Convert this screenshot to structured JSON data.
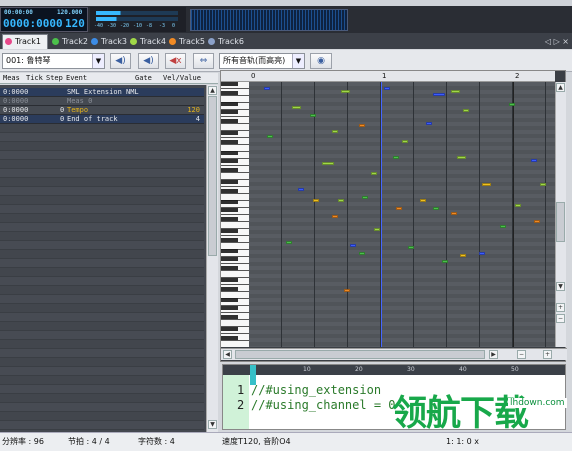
{
  "transport": {
    "label_1": "00:00:00",
    "label_2": "120.000",
    "position": "0000:0000",
    "tempo": "120",
    "meter_ticks": [
      "-40",
      "-30",
      "-20",
      "-10",
      "-8",
      "-3",
      "0"
    ]
  },
  "tabs": [
    {
      "label": "Track1",
      "color": "#e8488a",
      "active": true
    },
    {
      "label": "Track2",
      "color": "#4bc04b"
    },
    {
      "label": "Track3",
      "color": "#3c8ce6"
    },
    {
      "label": "Track4",
      "color": "#a0d848"
    },
    {
      "label": "Track5",
      "color": "#f08a24"
    },
    {
      "label": "Track6",
      "color": "#8aa0c8"
    }
  ],
  "tab_nav": "◁ ▷ ×",
  "toolbar": {
    "instrument": "001: 鲁特琴",
    "track_filter": "所有音轨(而高亮)"
  },
  "event_list": {
    "headers": [
      "Meas",
      "Tick",
      "Step",
      "Event",
      "Gate",
      "Vel/Value"
    ],
    "rows": [
      {
        "meas": "0:0000",
        "step": "",
        "event": "SML Extension NML",
        "value": "",
        "selected": true
      },
      {
        "meas": "0:0000",
        "step": "",
        "event": "Meas 0",
        "value": "",
        "selected": false,
        "dim": true
      },
      {
        "meas": "0:0000",
        "step": "0",
        "event": "Tempo",
        "value": "120",
        "selected": false,
        "tempo": true
      },
      {
        "meas": "0:0000",
        "step": "0",
        "event": "End of track",
        "value": "4",
        "selected": true
      }
    ]
  },
  "ruler": {
    "marks": [
      "0",
      "1",
      "2"
    ]
  },
  "script": {
    "lines": [
      {
        "num": "1",
        "text": "//#using_extension"
      },
      {
        "num": "2",
        "text": "//#using_channel = 0"
      }
    ],
    "ruler_marks": [
      "10",
      "20",
      "30",
      "40",
      "50"
    ]
  },
  "status": {
    "resolution": "分辨率 : 96",
    "beat": "节拍 : 4 / 4",
    "chars": "字符数 : 4",
    "tempo": "速度T120, 音阶O4",
    "position": "1: 1: 0 x"
  },
  "watermark": {
    "text": "领航下载",
    "url": "lhdown.com"
  },
  "notes": [
    {
      "t": 0.05,
      "p": 0.02,
      "w": 0.02,
      "c": "#3c5cff"
    },
    {
      "t": 0.3,
      "p": 0.03,
      "w": 0.03,
      "c": "#a0d848"
    },
    {
      "t": 0.44,
      "p": 0.02,
      "w": 0.02,
      "c": "#3c5cff"
    },
    {
      "t": 0.6,
      "p": 0.04,
      "w": 0.04,
      "c": "#3c5cff"
    },
    {
      "t": 0.66,
      "p": 0.03,
      "w": 0.03,
      "c": "#a0d848"
    },
    {
      "t": 0.14,
      "p": 0.09,
      "w": 0.03,
      "c": "#a0d848"
    },
    {
      "t": 0.2,
      "p": 0.12,
      "w": 0.02,
      "c": "#4bc04b"
    },
    {
      "t": 0.27,
      "p": 0.18,
      "w": 0.02,
      "c": "#a0d848"
    },
    {
      "t": 0.06,
      "p": 0.2,
      "w": 0.02,
      "c": "#4bc04b"
    },
    {
      "t": 0.36,
      "p": 0.16,
      "w": 0.02,
      "c": "#f08a24"
    },
    {
      "t": 0.58,
      "p": 0.15,
      "w": 0.02,
      "c": "#3c5cff"
    },
    {
      "t": 0.5,
      "p": 0.22,
      "w": 0.02,
      "c": "#a0d848"
    },
    {
      "t": 0.7,
      "p": 0.1,
      "w": 0.02,
      "c": "#a0d848"
    },
    {
      "t": 0.85,
      "p": 0.08,
      "w": 0.02,
      "c": "#4bc04b"
    },
    {
      "t": 0.24,
      "p": 0.3,
      "w": 0.04,
      "c": "#a0d848"
    },
    {
      "t": 0.4,
      "p": 0.34,
      "w": 0.02,
      "c": "#a0d848"
    },
    {
      "t": 0.47,
      "p": 0.28,
      "w": 0.02,
      "c": "#4bc04b"
    },
    {
      "t": 0.68,
      "p": 0.28,
      "w": 0.03,
      "c": "#a0d848"
    },
    {
      "t": 0.92,
      "p": 0.29,
      "w": 0.02,
      "c": "#3c5cff"
    },
    {
      "t": 0.95,
      "p": 0.38,
      "w": 0.02,
      "c": "#a0d848"
    },
    {
      "t": 0.16,
      "p": 0.4,
      "w": 0.02,
      "c": "#3c5cff"
    },
    {
      "t": 0.21,
      "p": 0.44,
      "w": 0.02,
      "c": "#f0c020"
    },
    {
      "t": 0.29,
      "p": 0.44,
      "w": 0.02,
      "c": "#a0d848"
    },
    {
      "t": 0.37,
      "p": 0.43,
      "w": 0.02,
      "c": "#4bc04b"
    },
    {
      "t": 0.56,
      "p": 0.44,
      "w": 0.02,
      "c": "#f0c020"
    },
    {
      "t": 0.76,
      "p": 0.38,
      "w": 0.03,
      "c": "#f0c020"
    },
    {
      "t": 0.87,
      "p": 0.46,
      "w": 0.02,
      "c": "#a0d848"
    },
    {
      "t": 0.48,
      "p": 0.47,
      "w": 0.02,
      "c": "#f08a24"
    },
    {
      "t": 0.6,
      "p": 0.47,
      "w": 0.02,
      "c": "#4bc04b"
    },
    {
      "t": 0.66,
      "p": 0.49,
      "w": 0.02,
      "c": "#f08a24"
    },
    {
      "t": 0.27,
      "p": 0.5,
      "w": 0.02,
      "c": "#f08a24"
    },
    {
      "t": 0.41,
      "p": 0.55,
      "w": 0.02,
      "c": "#a0d848"
    },
    {
      "t": 0.82,
      "p": 0.54,
      "w": 0.02,
      "c": "#4bc04b"
    },
    {
      "t": 0.12,
      "p": 0.6,
      "w": 0.02,
      "c": "#4bc04b"
    },
    {
      "t": 0.33,
      "p": 0.61,
      "w": 0.02,
      "c": "#3c5cff"
    },
    {
      "t": 0.93,
      "p": 0.52,
      "w": 0.02,
      "c": "#f08a24"
    },
    {
      "t": 0.36,
      "p": 0.64,
      "w": 0.02,
      "c": "#4bc04b"
    },
    {
      "t": 0.52,
      "p": 0.62,
      "w": 0.02,
      "c": "#4bc04b"
    },
    {
      "t": 0.69,
      "p": 0.65,
      "w": 0.02,
      "c": "#f0c020"
    },
    {
      "t": 0.75,
      "p": 0.64,
      "w": 0.02,
      "c": "#3c5cff"
    },
    {
      "t": 0.63,
      "p": 0.67,
      "w": 0.02,
      "c": "#4bc04b"
    },
    {
      "t": 0.31,
      "p": 0.78,
      "w": 0.02,
      "c": "#f08a24"
    }
  ],
  "colors": {
    "accent": "#37b8ff",
    "event_selected": "#2b3c5c",
    "tempo_text": "#e6b41a"
  }
}
